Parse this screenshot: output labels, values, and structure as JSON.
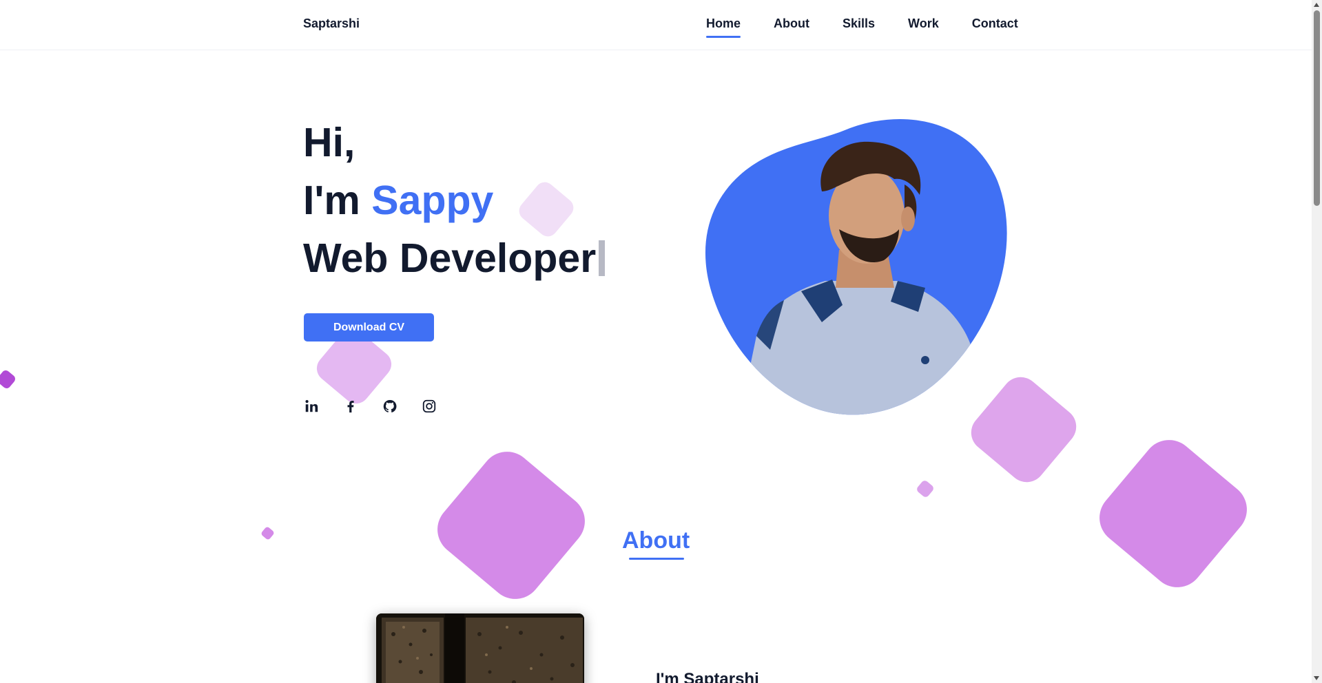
{
  "colors": {
    "accent": "#4070f4",
    "text": "#121a2e",
    "shape_purple": "#d48ae8",
    "shape_light": "#e0b8f2",
    "shape_pale": "#f1dcf7"
  },
  "header": {
    "logo": "Saptarshi",
    "nav": [
      {
        "label": "Home",
        "active": true
      },
      {
        "label": "About",
        "active": false
      },
      {
        "label": "Skills",
        "active": false
      },
      {
        "label": "Work",
        "active": false
      },
      {
        "label": "Contact",
        "active": false
      }
    ]
  },
  "hero": {
    "greeting": "Hi,",
    "intro_prefix": "I'm ",
    "name": "Sappy",
    "role": "Web Developer",
    "cv_button": "Download CV",
    "socials": [
      {
        "icon": "linkedin-icon"
      },
      {
        "icon": "facebook-icon"
      },
      {
        "icon": "github-icon"
      },
      {
        "icon": "instagram-icon"
      }
    ]
  },
  "about": {
    "heading": "About",
    "subtitle": "I'm Saptarshi"
  }
}
